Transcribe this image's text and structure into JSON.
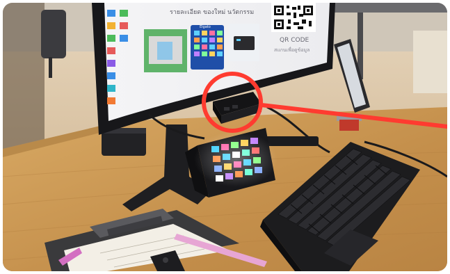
{
  "photo": {
    "screen_header": "รายละเอียด ของใหม่ นวัตกรรม",
    "qr_caption": "QR CODE",
    "qr_subcaption": "สแกนเพื่อดูข้อมูล",
    "app_tile_label": "Elgato"
  },
  "annotation": {
    "color": "#ff3b30",
    "shape": "circle-with-pointer-line"
  },
  "colors": {
    "desk": "#c99a55",
    "floor": "#d8c3a2",
    "keyboard": "#1c1c1e"
  }
}
